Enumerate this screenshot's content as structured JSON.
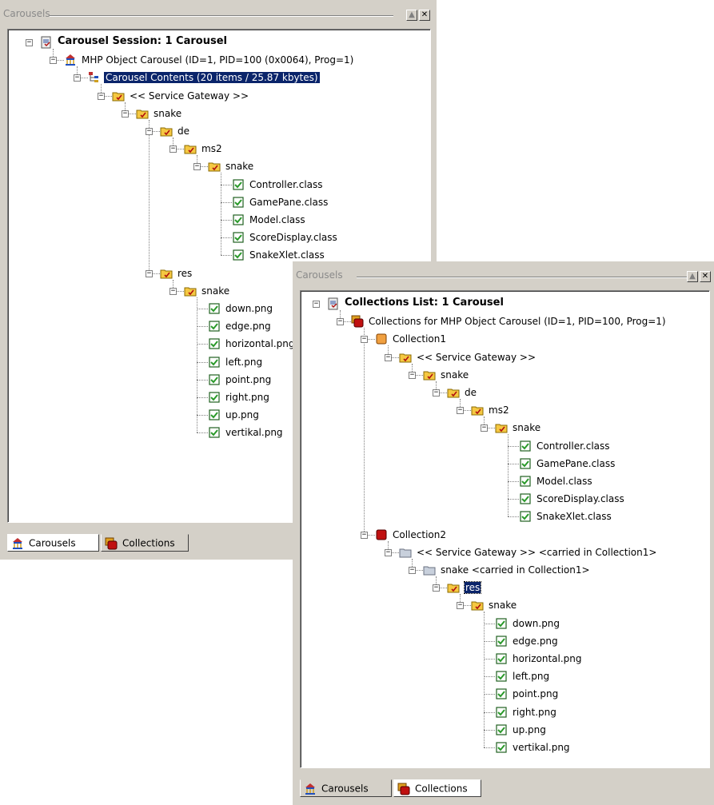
{
  "carousels_window": {
    "title": "Carousels",
    "tree": [
      {
        "label": "Carousel Session: 1 Carousel",
        "icon": "session-icon",
        "bold": true
      },
      {
        "label": "MHP Object Carousel (ID=1, PID=100 (0x0064), Prog=1)",
        "icon": "carousel-icon"
      },
      {
        "label": "Carousel Contents (20 items / 25.87 kbytes)",
        "icon": "contents-icon",
        "selected": true
      },
      {
        "label": "<< Service Gateway >>",
        "icon": "folder-icon"
      },
      {
        "label": "snake",
        "icon": "folder-icon"
      },
      {
        "label": "de",
        "icon": "folder-icon"
      },
      {
        "label": "ms2",
        "icon": "folder-icon"
      },
      {
        "label": "snake",
        "icon": "folder-icon"
      },
      {
        "label": "Controller.class",
        "icon": "file-check-icon"
      },
      {
        "label": "GamePane.class",
        "icon": "file-check-icon"
      },
      {
        "label": "Model.class",
        "icon": "file-check-icon"
      },
      {
        "label": "ScoreDisplay.class",
        "icon": "file-check-icon"
      },
      {
        "label": "SnakeXlet.class",
        "icon": "file-check-icon"
      },
      {
        "label": "res",
        "icon": "folder-icon"
      },
      {
        "label": "snake",
        "icon": "folder-icon"
      },
      {
        "label": "down.png",
        "icon": "file-check-icon"
      },
      {
        "label": "edge.png",
        "icon": "file-check-icon"
      },
      {
        "label": "horizontal.png",
        "icon": "file-check-icon"
      },
      {
        "label": "left.png",
        "icon": "file-check-icon"
      },
      {
        "label": "point.png",
        "icon": "file-check-icon"
      },
      {
        "label": "right.png",
        "icon": "file-check-icon"
      },
      {
        "label": "up.png",
        "icon": "file-check-icon"
      },
      {
        "label": "vertikal.png",
        "icon": "file-check-icon"
      }
    ],
    "tabs": [
      {
        "label": "Carousels",
        "icon": "carousel-icon",
        "active": true
      },
      {
        "label": "Collections",
        "icon": "collections-icon",
        "active": false
      }
    ]
  },
  "collections_window": {
    "title": "Carousels",
    "tree": [
      {
        "label": "Collections List: 1 Carousel",
        "icon": "session-icon",
        "bold": true
      },
      {
        "label": "Collections for MHP Object Carousel (ID=1, PID=100, Prog=1)",
        "icon": "collections-icon"
      },
      {
        "label": "Collection1",
        "icon": "collection-orange-icon"
      },
      {
        "label": "<< Service Gateway >>",
        "icon": "folder-icon"
      },
      {
        "label": "snake",
        "icon": "folder-icon"
      },
      {
        "label": "de",
        "icon": "folder-icon"
      },
      {
        "label": "ms2",
        "icon": "folder-icon"
      },
      {
        "label": "snake",
        "icon": "folder-icon"
      },
      {
        "label": "Controller.class",
        "icon": "file-check-icon"
      },
      {
        "label": "GamePane.class",
        "icon": "file-check-icon"
      },
      {
        "label": "Model.class",
        "icon": "file-check-icon"
      },
      {
        "label": "ScoreDisplay.class",
        "icon": "file-check-icon"
      },
      {
        "label": "SnakeXlet.class",
        "icon": "file-check-icon"
      },
      {
        "label": "Collection2",
        "icon": "collection-red-icon"
      },
      {
        "label": "<< Service Gateway >> <carried in Collection1>",
        "icon": "folder-grey-icon"
      },
      {
        "label": "snake <carried in Collection1>",
        "icon": "folder-grey-icon"
      },
      {
        "label": "res",
        "icon": "folder-icon",
        "focused": true
      },
      {
        "label": "snake",
        "icon": "folder-icon"
      },
      {
        "label": "down.png",
        "icon": "file-check-icon"
      },
      {
        "label": "edge.png",
        "icon": "file-check-icon"
      },
      {
        "label": "horizontal.png",
        "icon": "file-check-icon"
      },
      {
        "label": "left.png",
        "icon": "file-check-icon"
      },
      {
        "label": "point.png",
        "icon": "file-check-icon"
      },
      {
        "label": "right.png",
        "icon": "file-check-icon"
      },
      {
        "label": "up.png",
        "icon": "file-check-icon"
      },
      {
        "label": "vertikal.png",
        "icon": "file-check-icon"
      }
    ],
    "tabs": [
      {
        "label": "Carousels",
        "icon": "carousel-icon",
        "active": false
      },
      {
        "label": "Collections",
        "icon": "collections-icon",
        "active": true
      }
    ]
  },
  "colors": {
    "selection": "#0a246a",
    "panel": "#d4d0c8",
    "folder": "#f5c842",
    "check": "#2a9a2a"
  }
}
